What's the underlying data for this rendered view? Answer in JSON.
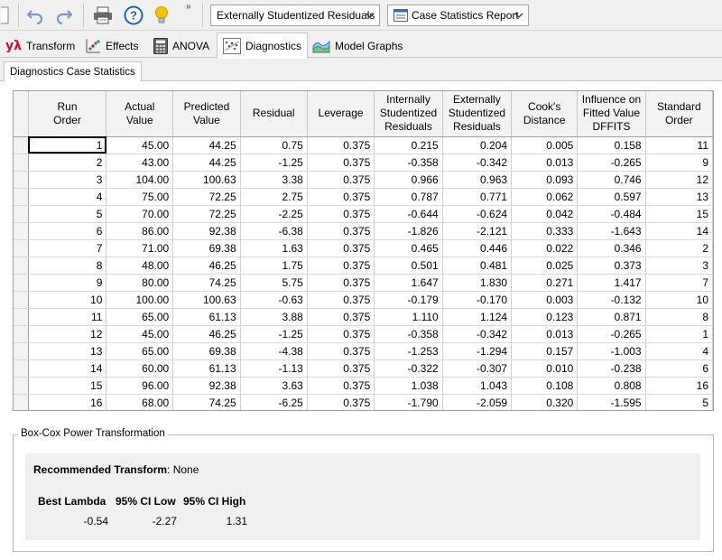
{
  "toolbar": {
    "response_dropdown": "Externally Studentized Residuals",
    "report_dropdown": "Case Statistics Report"
  },
  "tabs": [
    {
      "label": "Transform",
      "icon": "lambda-icon"
    },
    {
      "label": "Effects",
      "icon": "effects-icon"
    },
    {
      "label": "ANOVA",
      "icon": "calculator-icon"
    },
    {
      "label": "Diagnostics",
      "icon": "diagnostics-icon"
    },
    {
      "label": "Model Graphs",
      "icon": "model-graphs-icon"
    }
  ],
  "active_tab": "Diagnostics",
  "subtab": "Diagnostics Case Statistics",
  "table": {
    "headers": [
      [
        "Run",
        "Order"
      ],
      [
        "Actual",
        "Value"
      ],
      [
        "Predicted",
        "Value"
      ],
      [
        "Residual"
      ],
      [
        "Leverage"
      ],
      [
        "Internally",
        "Studentized",
        "Residuals"
      ],
      [
        "Externally",
        "Studentized",
        "Residuals"
      ],
      [
        "Cook's",
        "Distance"
      ],
      [
        "Influence on",
        "Fitted Value",
        "DFFITS"
      ],
      [
        "Standard",
        "Order"
      ]
    ],
    "rows": [
      [
        "1",
        "45.00",
        "44.25",
        "0.75",
        "0.375",
        "0.215",
        "0.204",
        "0.005",
        "0.158",
        "11"
      ],
      [
        "2",
        "43.00",
        "44.25",
        "-1.25",
        "0.375",
        "-0.358",
        "-0.342",
        "0.013",
        "-0.265",
        "9"
      ],
      [
        "3",
        "104.00",
        "100.63",
        "3.38",
        "0.375",
        "0.966",
        "0.963",
        "0.093",
        "0.746",
        "12"
      ],
      [
        "4",
        "75.00",
        "72.25",
        "2.75",
        "0.375",
        "0.787",
        "0.771",
        "0.062",
        "0.597",
        "13"
      ],
      [
        "5",
        "70.00",
        "72.25",
        "-2.25",
        "0.375",
        "-0.644",
        "-0.624",
        "0.042",
        "-0.484",
        "15"
      ],
      [
        "6",
        "86.00",
        "92.38",
        "-6.38",
        "0.375",
        "-1.826",
        "-2.121",
        "0.333",
        "-1.643",
        "14"
      ],
      [
        "7",
        "71.00",
        "69.38",
        "1.63",
        "0.375",
        "0.465",
        "0.446",
        "0.022",
        "0.346",
        "2"
      ],
      [
        "8",
        "48.00",
        "46.25",
        "1.75",
        "0.375",
        "0.501",
        "0.481",
        "0.025",
        "0.373",
        "3"
      ],
      [
        "9",
        "80.00",
        "74.25",
        "5.75",
        "0.375",
        "1.647",
        "1.830",
        "0.271",
        "1.417",
        "7"
      ],
      [
        "10",
        "100.00",
        "100.63",
        "-0.63",
        "0.375",
        "-0.179",
        "-0.170",
        "0.003",
        "-0.132",
        "10"
      ],
      [
        "11",
        "65.00",
        "61.13",
        "3.88",
        "0.375",
        "1.110",
        "1.124",
        "0.123",
        "0.871",
        "8"
      ],
      [
        "12",
        "45.00",
        "46.25",
        "-1.25",
        "0.375",
        "-0.358",
        "-0.342",
        "0.013",
        "-0.265",
        "1"
      ],
      [
        "13",
        "65.00",
        "69.38",
        "-4.38",
        "0.375",
        "-1.253",
        "-1.294",
        "0.157",
        "-1.003",
        "4"
      ],
      [
        "14",
        "60.00",
        "61.13",
        "-1.13",
        "0.375",
        "-0.322",
        "-0.307",
        "0.010",
        "-0.238",
        "6"
      ],
      [
        "15",
        "96.00",
        "92.38",
        "3.63",
        "0.375",
        "1.038",
        "1.043",
        "0.108",
        "0.808",
        "16"
      ],
      [
        "16",
        "68.00",
        "74.25",
        "-6.25",
        "0.375",
        "-1.790",
        "-2.059",
        "0.320",
        "-1.595",
        "5"
      ]
    ]
  },
  "box_cox": {
    "title": "Box-Cox Power Transformation",
    "recommended_label": "Recommended Transform",
    "recommended_value": ": None",
    "col_best_lambda": "Best Lambda",
    "col_ci_low": "95% CI Low",
    "col_ci_high": "95% CI High",
    "best_lambda": "-0.54",
    "ci_low": "-2.27",
    "ci_high": "1.31"
  },
  "colors": {
    "lambda": "#c8102e",
    "help": "#1f5fbf",
    "bulb": "#f5c400"
  }
}
